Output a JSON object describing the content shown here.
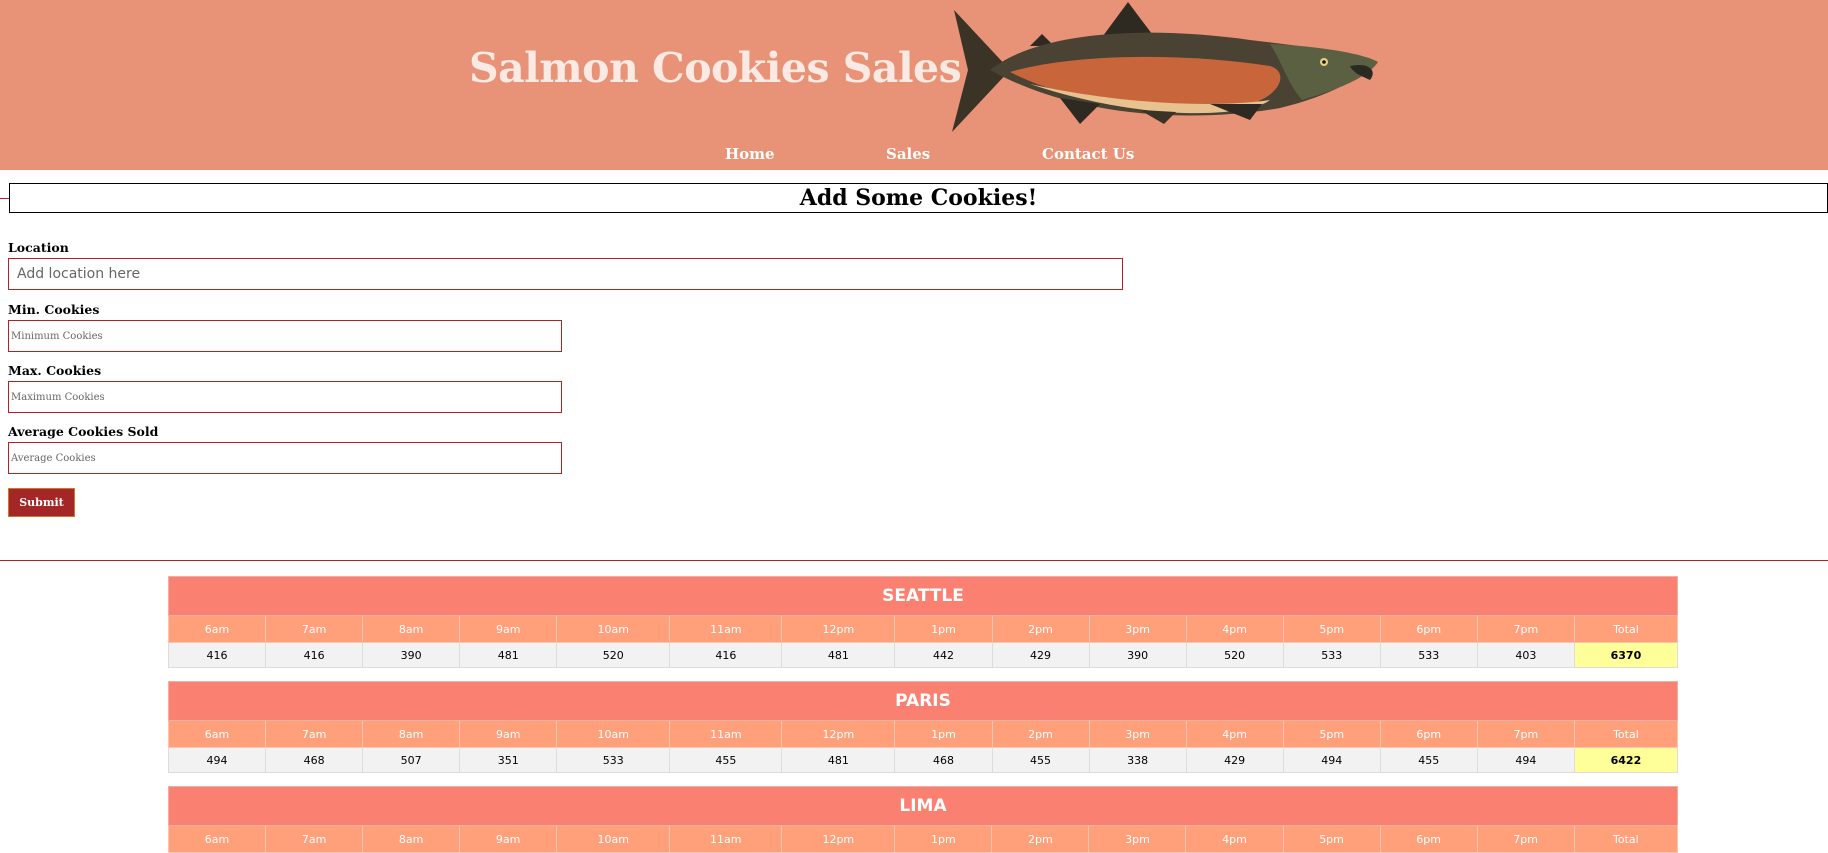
{
  "header": {
    "title": "Salmon Cookies Sales",
    "image": "salmon-fish-illustration",
    "nav": [
      "Home",
      "Sales",
      "Contact Us"
    ]
  },
  "form": {
    "heading": "Add Some Cookies!",
    "location_label": "Location",
    "location_placeholder": "Add location here",
    "min_label": "Min. Cookies",
    "min_placeholder": "Minimum Cookies",
    "max_label": "Max. Cookies",
    "max_placeholder": "Maximum Cookies",
    "avg_label": "Average Cookies Sold",
    "avg_placeholder": "Average Cookies",
    "submit_label": "Submit"
  },
  "colors": {
    "header_bg": "#e89377",
    "city_header": "#fa8072",
    "hour_header": "#ffa07a",
    "total_cell": "#ffff99",
    "accent_red": "#b22222"
  },
  "hours": [
    "6am",
    "7am",
    "8am",
    "9am",
    "10am",
    "11am",
    "12pm",
    "1pm",
    "2pm",
    "3pm",
    "4pm",
    "5pm",
    "6pm",
    "7pm",
    "Total"
  ],
  "stores": [
    {
      "name": "SEATTLE",
      "values": [
        "416",
        "416",
        "390",
        "481",
        "520",
        "416",
        "481",
        "442",
        "429",
        "390",
        "520",
        "533",
        "533",
        "403",
        "6370"
      ]
    },
    {
      "name": "PARIS",
      "values": [
        "494",
        "468",
        "507",
        "351",
        "533",
        "455",
        "481",
        "468",
        "455",
        "338",
        "429",
        "494",
        "455",
        "494",
        "6422"
      ]
    },
    {
      "name": "LIMA",
      "values": []
    }
  ]
}
